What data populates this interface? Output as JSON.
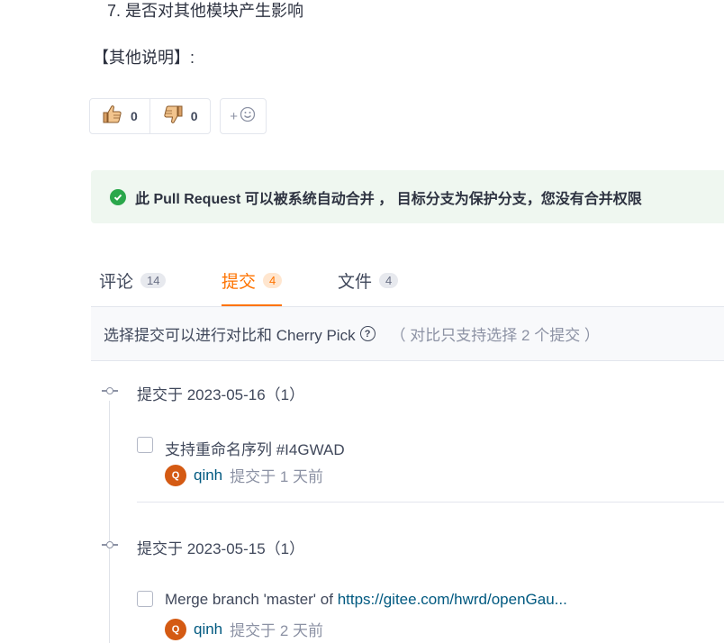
{
  "description": {
    "list_item": "7. 是否对其他模块产生影响",
    "note": "【其他说明】:"
  },
  "reactions": {
    "thumbs_up_count": "0",
    "thumbs_down_count": "0",
    "add_label": "+"
  },
  "merge_status": {
    "message": "此 Pull Request 可以被系统自动合并 ， 目标分支为保护分支，您没有合并权限",
    "color": "#2aa74b"
  },
  "tabs": [
    {
      "label": "评论",
      "count": "14"
    },
    {
      "label": "提交",
      "count": "4"
    },
    {
      "label": "文件",
      "count": "4"
    }
  ],
  "commits_hint": {
    "main": "选择提交可以进行对比和 Cherry Pick",
    "help": "?",
    "sub": "（ 对比只支持选择 2 个提交 ）"
  },
  "commit_groups": [
    {
      "title": "提交于 2023-05-16（1）",
      "commits": [
        {
          "title_prefix": "支持重命名序列 #I4GWAD",
          "title_link": "",
          "avatar": "Q",
          "author": "qinh",
          "time": "提交于 1 天前"
        }
      ]
    },
    {
      "title": "提交于 2023-05-15（1）",
      "commits": [
        {
          "title_prefix": "Merge branch 'master' of ",
          "title_link": "https://gitee.com/hwrd/openGau...",
          "avatar": "Q",
          "author": "qinh",
          "time": "提交于 2 天前"
        }
      ]
    }
  ],
  "colors": {
    "accent": "#fe7300",
    "link": "#005980",
    "avatar": "#d45a13"
  }
}
